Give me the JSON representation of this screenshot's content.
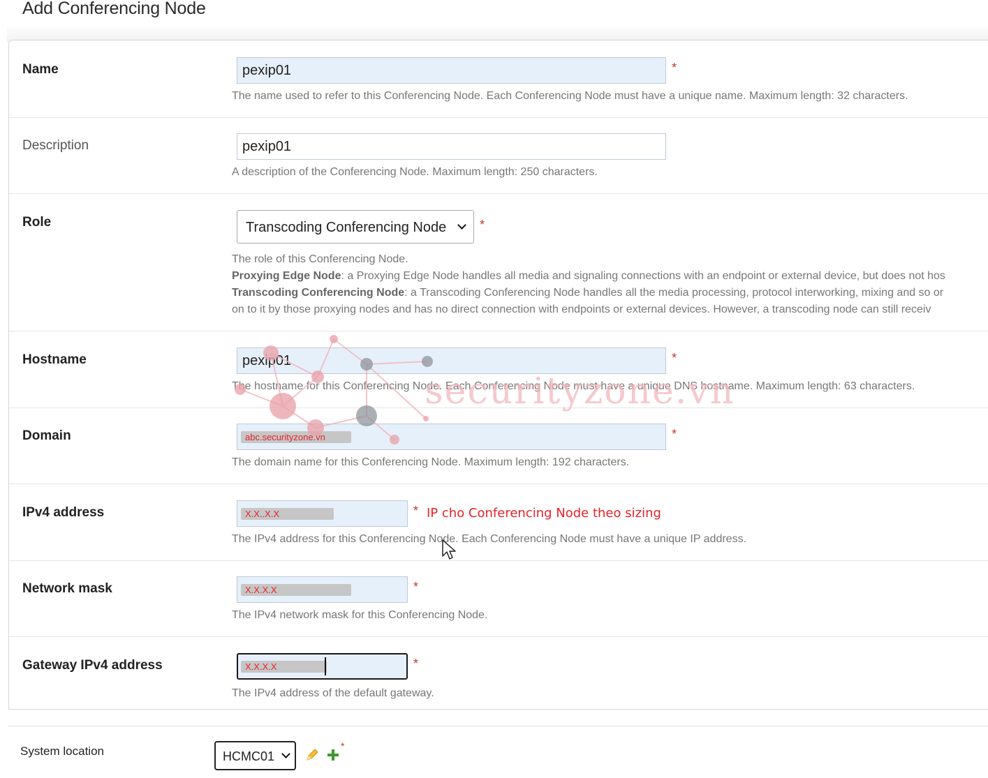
{
  "page": {
    "title": "Add Conferencing Node"
  },
  "fields": {
    "name": {
      "label": "Name",
      "value": "pexip01",
      "help": "The name used to refer to this Conferencing Node. Each Conferencing Node must have a unique name. Maximum length: 32 characters.",
      "required": "*"
    },
    "description": {
      "label": "Description",
      "value": "pexip01",
      "help": "A description of the Conferencing Node. Maximum length: 250 characters."
    },
    "role": {
      "label": "Role",
      "value": "Transcoding Conferencing Node",
      "required": "*",
      "help_intro": "The role of this Conferencing Node.",
      "help_proxy_term": "Proxying Edge Node",
      "help_proxy_text": ": a Proxying Edge Node handles all media and signaling connections with an endpoint or external device, but does not hos",
      "help_trans_term": "Transcoding Conferencing Node",
      "help_trans_text": ": a Transcoding Conferencing Node handles all the media processing, protocol interworking, mixing and so or",
      "help_trans_cont": "on to it by those proxying nodes and has no direct connection with endpoints or external devices. However, a transcoding node can still receiv"
    },
    "hostname": {
      "label": "Hostname",
      "value": "pexip01",
      "help": "The hostname for this Conferencing Node. Each Conferencing Node must have a unique DNS hostname. Maximum length: 63 characters.",
      "required": "*"
    },
    "domain": {
      "label": "Domain",
      "value": "abc.securityzone.vn",
      "help": "The domain name for this Conferencing Node. Maximum length: 192 characters.",
      "required": "*"
    },
    "ipv4": {
      "label": "IPv4 address",
      "value": "X.X..X.X",
      "help": "The IPv4 address for this Conferencing Node. Each Conferencing Node must have a unique IP address.",
      "required": "*",
      "annotation": "IP cho Conferencing Node theo sizing"
    },
    "netmask": {
      "label": "Network mask",
      "value": "X.X.X.X",
      "help": "The IPv4 network mask for this Conferencing Node.",
      "required": "*"
    },
    "gateway": {
      "label": "Gateway IPv4 address",
      "value": "X.X.X.X",
      "help": "The IPv4 address of the default gateway.",
      "required": "*"
    },
    "system_location": {
      "label": "System location",
      "value": "HCMC01",
      "required": "*"
    }
  },
  "watermark": {
    "text": "securityzone.vn"
  },
  "icons": {
    "edit": "pencil-icon",
    "add": "plus-icon"
  },
  "colors": {
    "required": "#c0392b",
    "annotation": "#e8222a",
    "input_bg": "#e6f0fb",
    "add": "#3c9a2c",
    "edit": "#e0a800"
  }
}
